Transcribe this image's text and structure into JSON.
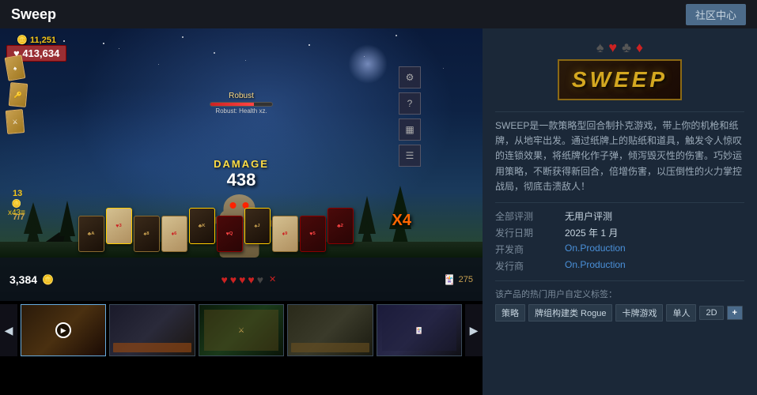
{
  "header": {
    "title": "Sweep",
    "community_button": "社区中心"
  },
  "game": {
    "hud": {
      "coins": "11,251",
      "score": "♥ 413,634",
      "damage_label": "DAMAGE",
      "damage_value": "438",
      "multiplier": "X4",
      "score_total": "3,384",
      "deck_remaining": "275",
      "hand_count": "7/7",
      "stamina": "13"
    },
    "monster": {
      "name": "Robust",
      "health_label": "Robust: Health xz."
    },
    "bottom_cards": [
      {
        "suit": "♣",
        "type": "dark"
      },
      {
        "suit": "♥",
        "type": "red-card"
      },
      {
        "suit": "♠",
        "type": "dark"
      },
      {
        "suit": "♦",
        "type": "red-card"
      },
      {
        "suit": "♣",
        "type": "dark",
        "selected": true
      },
      {
        "suit": "♥",
        "type": "blood"
      },
      {
        "suit": "♠",
        "type": "dark",
        "selected": true
      },
      {
        "suit": "♦",
        "type": "red-card"
      },
      {
        "suit": "♣",
        "type": "blood"
      },
      {
        "suit": "♥",
        "type": "blood",
        "selected": true
      }
    ],
    "hearts": [
      true,
      true,
      true,
      true,
      false
    ]
  },
  "thumbnails": [
    {
      "label": "thumb1",
      "has_play": true,
      "active": true
    },
    {
      "label": "thumb2",
      "has_play": false,
      "active": false
    },
    {
      "label": "thumb3",
      "has_play": false,
      "active": false
    },
    {
      "label": "thumb4",
      "has_play": false,
      "active": false
    },
    {
      "label": "thumb5",
      "has_play": false,
      "active": false
    }
  ],
  "info_panel": {
    "logo_text": "SWEEP",
    "description": "SWEEP是一款策略型回合制扑克游戏，带上你的机枪和纸牌，从地牢出发。通过纸牌上的贴纸和道具，触发令人惊叹的连锁效果，将纸牌化作子弹，倾泻毁灭性的伤害。巧妙运用策略，不断获得新回合，倍增伤害，以压倒性的火力掌控战局，彻底击溃敌人！",
    "review_label": "全部评测",
    "review_value": "无用户评测",
    "release_label": "发行日期",
    "release_value": "2025 年 1 月",
    "developer_label": "开发商",
    "developer_value": "On.Production",
    "publisher_label": "发行商",
    "publisher_value": "On.Production",
    "tags_label": "该产品的热门用户自定义标签：",
    "tags": [
      "策略",
      "牌组构建类 Rogue",
      "卡牌游戏",
      "单人",
      "2D"
    ],
    "plus_label": "+"
  },
  "nav": {
    "left_arrow": "◀",
    "right_arrow": "▶"
  }
}
